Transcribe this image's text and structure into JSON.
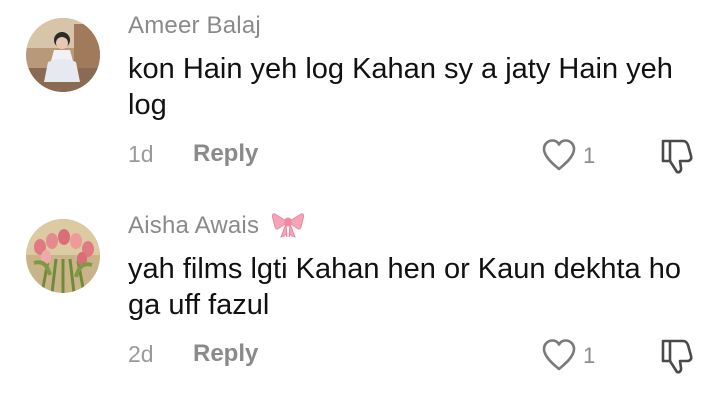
{
  "comments": [
    {
      "author": "Ameer Balaj",
      "author_badge": "",
      "text": "kon Hain yeh log Kahan sy a jaty Hain yeh log",
      "time": "1d",
      "reply_label": "Reply",
      "like_count": "1",
      "avatar_icon": "child-in-white-dress-photo",
      "like_icon": "heart-outline-icon",
      "dislike_icon": "thumbs-down-outline-icon"
    },
    {
      "author": "Aisha Awais",
      "author_badge": "pink-bow-emoji",
      "text": "yah films lgti Kahan hen or Kaun dekhta ho ga uff fazul",
      "time": "2d",
      "reply_label": "Reply",
      "like_count": "1",
      "avatar_icon": "tulip-bouquet-photo",
      "like_icon": "heart-outline-icon",
      "dislike_icon": "thumbs-down-outline-icon"
    }
  ],
  "colors": {
    "author": "#8a8a8a",
    "body_text": "#111111",
    "meta": "#9a9a9a",
    "bow": "#f4a6b8"
  }
}
